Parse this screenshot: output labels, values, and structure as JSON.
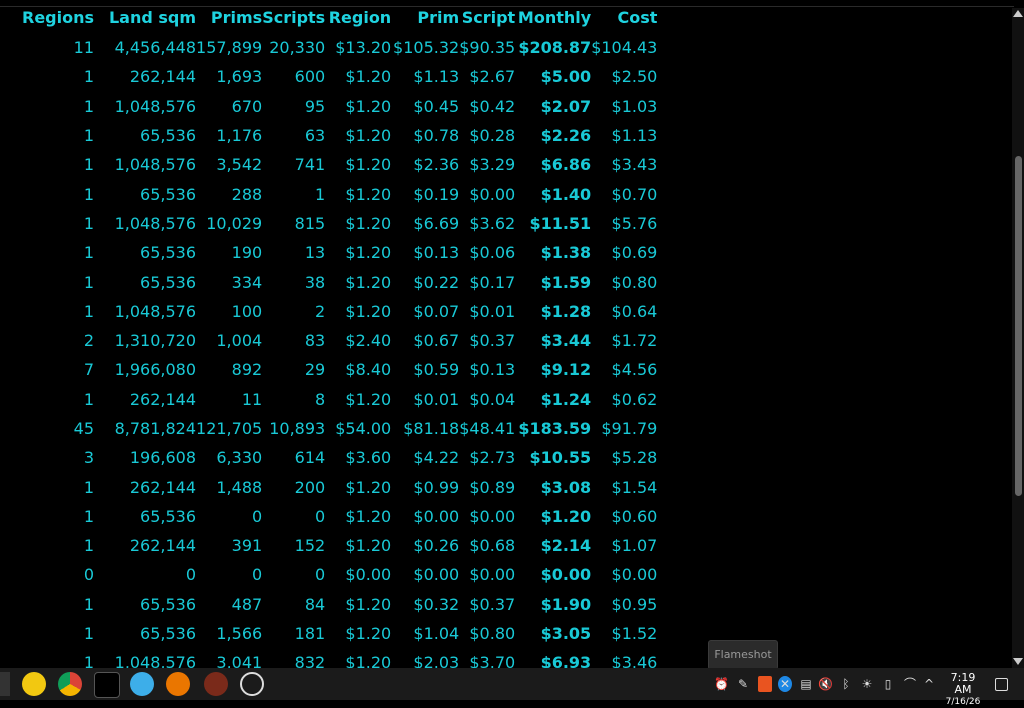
{
  "table": {
    "headers": [
      "Regions",
      "Land sqm",
      "Prims",
      "Scripts",
      "Region",
      "Prim",
      "Script",
      "Monthly",
      "Cost"
    ],
    "rows": [
      [
        "11",
        "4,456,448",
        "157,899",
        "20,330",
        "$13.20",
        "$105.32",
        "$90.35",
        "$208.87",
        "$104.43"
      ],
      [
        "1",
        "262,144",
        "1,693",
        "600",
        "$1.20",
        "$1.13",
        "$2.67",
        "$5.00",
        "$2.50"
      ],
      [
        "1",
        "1,048,576",
        "670",
        "95",
        "$1.20",
        "$0.45",
        "$0.42",
        "$2.07",
        "$1.03"
      ],
      [
        "1",
        "65,536",
        "1,176",
        "63",
        "$1.20",
        "$0.78",
        "$0.28",
        "$2.26",
        "$1.13"
      ],
      [
        "1",
        "1,048,576",
        "3,542",
        "741",
        "$1.20",
        "$2.36",
        "$3.29",
        "$6.86",
        "$3.43"
      ],
      [
        "1",
        "65,536",
        "288",
        "1",
        "$1.20",
        "$0.19",
        "$0.00",
        "$1.40",
        "$0.70"
      ],
      [
        "1",
        "1,048,576",
        "10,029",
        "815",
        "$1.20",
        "$6.69",
        "$3.62",
        "$11.51",
        "$5.76"
      ],
      [
        "1",
        "65,536",
        "190",
        "13",
        "$1.20",
        "$0.13",
        "$0.06",
        "$1.38",
        "$0.69"
      ],
      [
        "1",
        "65,536",
        "334",
        "38",
        "$1.20",
        "$0.22",
        "$0.17",
        "$1.59",
        "$0.80"
      ],
      [
        "1",
        "1,048,576",
        "100",
        "2",
        "$1.20",
        "$0.07",
        "$0.01",
        "$1.28",
        "$0.64"
      ],
      [
        "2",
        "1,310,720",
        "1,004",
        "83",
        "$2.40",
        "$0.67",
        "$0.37",
        "$3.44",
        "$1.72"
      ],
      [
        "7",
        "1,966,080",
        "892",
        "29",
        "$8.40",
        "$0.59",
        "$0.13",
        "$9.12",
        "$4.56"
      ],
      [
        "1",
        "262,144",
        "11",
        "8",
        "$1.20",
        "$0.01",
        "$0.04",
        "$1.24",
        "$0.62"
      ],
      [
        "45",
        "8,781,824",
        "121,705",
        "10,893",
        "$54.00",
        "$81.18",
        "$48.41",
        "$183.59",
        "$91.79"
      ],
      [
        "3",
        "196,608",
        "6,330",
        "614",
        "$3.60",
        "$4.22",
        "$2.73",
        "$10.55",
        "$5.28"
      ],
      [
        "1",
        "262,144",
        "1,488",
        "200",
        "$1.20",
        "$0.99",
        "$0.89",
        "$3.08",
        "$1.54"
      ],
      [
        "1",
        "65,536",
        "0",
        "0",
        "$1.20",
        "$0.00",
        "$0.00",
        "$1.20",
        "$0.60"
      ],
      [
        "1",
        "262,144",
        "391",
        "152",
        "$1.20",
        "$0.26",
        "$0.68",
        "$2.14",
        "$1.07"
      ],
      [
        "0",
        "0",
        "0",
        "0",
        "$0.00",
        "$0.00",
        "$0.00",
        "$0.00",
        "$0.00"
      ],
      [
        "1",
        "65,536",
        "487",
        "84",
        "$1.20",
        "$0.32",
        "$0.37",
        "$1.90",
        "$0.95"
      ],
      [
        "1",
        "65,536",
        "1,566",
        "181",
        "$1.20",
        "$1.04",
        "$0.80",
        "$3.05",
        "$1.52"
      ],
      [
        "1",
        "1,048,576",
        "3,041",
        "832",
        "$1.20",
        "$2.03",
        "$3.70",
        "$6.93",
        "$3.46"
      ]
    ]
  },
  "tooltip": "Flameshot",
  "clock": {
    "time": "7:19 AM",
    "date": "7/16/26"
  },
  "taskbar_apps": [
    "pikachu-icon",
    "chrome-icon",
    "inkscape-icon",
    "kde-connect-icon",
    "blender-icon",
    "game-icon",
    "basketball-icon"
  ],
  "tray_icons": [
    "alarm-icon",
    "pen-icon",
    "ubuntu-icon",
    "x-icon",
    "clipboard-icon",
    "volume-muted-icon",
    "bluetooth-icon",
    "brightness-icon",
    "battery-icon",
    "wifi-icon",
    "chevron-up-icon"
  ],
  "colors": {
    "text": "#19c9d6",
    "header": "#1fd3e0",
    "background": "#000000"
  }
}
